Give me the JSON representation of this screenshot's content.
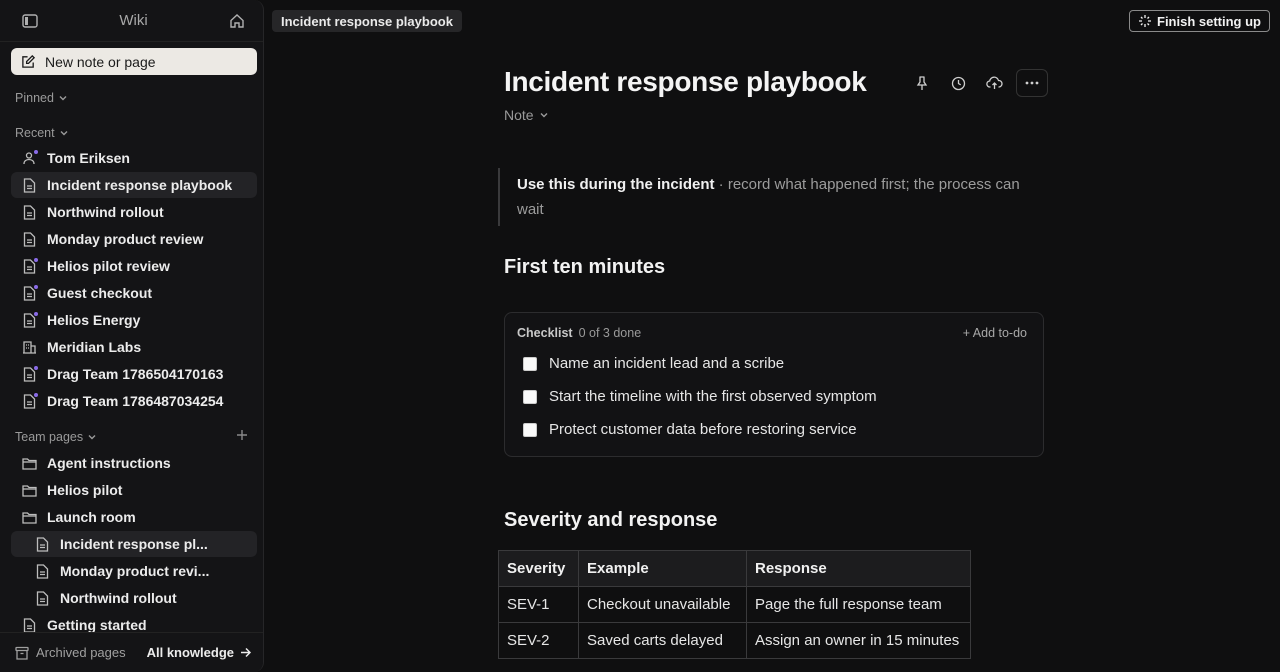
{
  "sidebar": {
    "title": "Wiki",
    "new_note_label": "New note or page",
    "pinned_label": "Pinned",
    "recent_label": "Recent",
    "recent_items": [
      {
        "label": "Tom Eriksen",
        "icon": "user-icon"
      },
      {
        "label": "Incident response playbook",
        "icon": "document-icon"
      },
      {
        "label": "Northwind rollout",
        "icon": "document-icon"
      },
      {
        "label": "Monday product review",
        "icon": "document-icon"
      },
      {
        "label": "Helios pilot review",
        "icon": "document-icon"
      },
      {
        "label": "Guest checkout",
        "icon": "document-icon"
      },
      {
        "label": "Helios Energy",
        "icon": "document-icon"
      },
      {
        "label": "Meridian Labs",
        "icon": "building-icon"
      },
      {
        "label": "Drag Team 1786504170163",
        "icon": "document-icon"
      },
      {
        "label": "Drag Team 1786487034254",
        "icon": "document-icon"
      }
    ],
    "team_pages_label": "Team pages",
    "team_items": [
      {
        "label": "Agent instructions",
        "icon": "folder-icon"
      },
      {
        "label": "Helios pilot",
        "icon": "folder-icon"
      },
      {
        "label": "Launch room",
        "icon": "folder-icon"
      },
      {
        "label": "Incident response pl...",
        "icon": "document-icon"
      },
      {
        "label": "Monday product revi...",
        "icon": "document-icon"
      },
      {
        "label": "Northwind rollout",
        "icon": "document-icon"
      },
      {
        "label": "Getting started",
        "icon": "document-icon"
      }
    ],
    "archived_label": "Archived pages",
    "all_knowledge_label": "All knowledge"
  },
  "topbar": {
    "breadcrumb": "Incident response playbook",
    "finish_label": "Finish setting up"
  },
  "doc": {
    "title": "Incident response playbook",
    "type": "Note",
    "callout_bold": "Use this during the incident",
    "callout_rest": " · record what happened first; the process can wait",
    "section1": "First ten minutes",
    "checklist": {
      "label": "Checklist",
      "progress": "0 of 3 done",
      "add_label": "+ Add to-do",
      "items": [
        "Name an incident lead and a scribe",
        "Start the timeline with the first observed symptom",
        "Protect customer data before restoring service"
      ]
    },
    "section2": "Severity and response",
    "table": {
      "headers": [
        "Severity",
        "Example",
        "Response"
      ],
      "rows": [
        [
          "SEV-1",
          "Checkout unavailable",
          "Page the full response team"
        ],
        [
          "SEV-2",
          "Saved carts delayed",
          "Assign an owner in 15 minutes"
        ]
      ]
    }
  },
  "colors": {
    "background": "#0f0f10",
    "sidebar": "#141416",
    "new_note_bg": "#ece9e4",
    "presence_dot": "#8a6ce8"
  }
}
